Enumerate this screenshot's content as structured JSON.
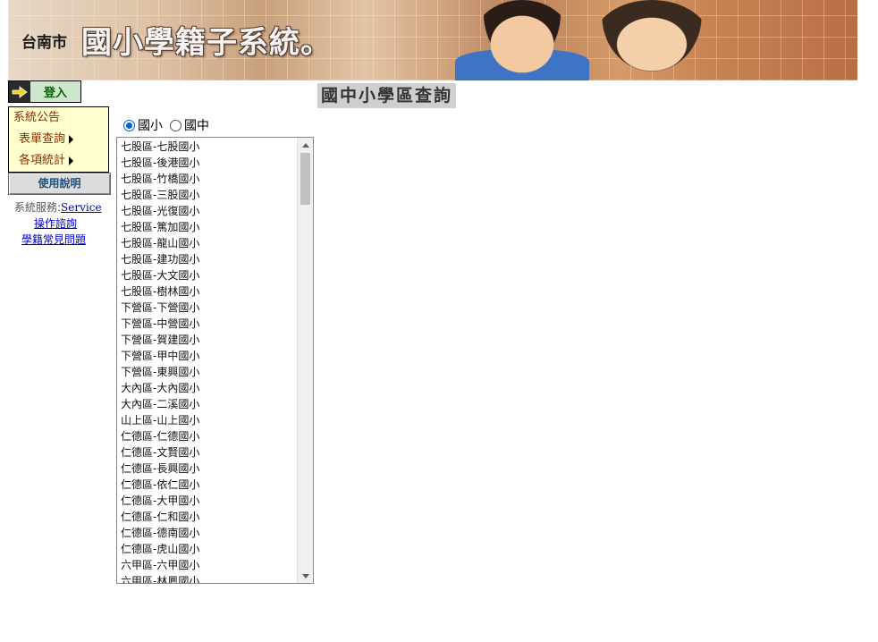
{
  "banner": {
    "city": "台南市",
    "title": "國小學籍子系統。"
  },
  "login": {
    "label": "登入",
    "icon": "login-arrow-icon"
  },
  "menu": {
    "items": [
      {
        "label": "系統公告",
        "has_submenu": false
      },
      {
        "label": "表單查詢",
        "has_submenu": true
      },
      {
        "label": "各項統計",
        "has_submenu": true
      }
    ]
  },
  "help_button": {
    "label": "使用說明"
  },
  "service": {
    "prefix": "系統服務:",
    "link": "Service"
  },
  "links": {
    "consult": "操作諮詢",
    "faq": "學籍常見問題"
  },
  "page_title": "國中小學區查詢",
  "school_type": {
    "options": [
      {
        "label": "國小",
        "selected": true
      },
      {
        "label": "國中",
        "selected": false
      }
    ]
  },
  "school_list": [
    "七股區-七股國小",
    "七股區-後港國小",
    "七股區-竹橋國小",
    "七股區-三股國小",
    "七股區-光復國小",
    "七股區-篤加國小",
    "七股區-龍山國小",
    "七股區-建功國小",
    "七股區-大文國小",
    "七股區-樹林國小",
    "下營區-下營國小",
    "下營區-中營國小",
    "下營區-賀建國小",
    "下營區-甲中國小",
    "下營區-東興國小",
    "大內區-大內國小",
    "大內區-二溪國小",
    "山上區-山上國小",
    "仁德區-仁德國小",
    "仁德區-文賢國小",
    "仁德區-長興國小",
    "仁德區-依仁國小",
    "仁德區-大甲國小",
    "仁德區-仁和國小",
    "仁德區-德南國小",
    "仁德區-虎山國小",
    "六甲區-六甲國小",
    "六甲區-林鳳國小"
  ],
  "colors": {
    "menu_bg": "#ffffd0",
    "menu_text": "#8b2a00",
    "login_text": "#006400",
    "link": "#0000cc",
    "title_bg": "#cfcfcf"
  }
}
